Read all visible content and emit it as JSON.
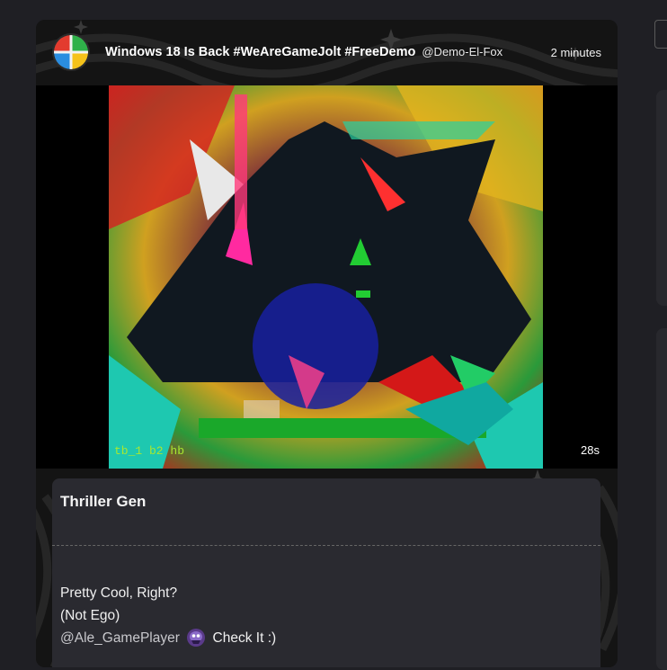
{
  "post": {
    "title": "Windows 18 Is Back #WeAreGameJolt #FreeDemo",
    "username": "@Demo-El-Fox",
    "time": "2 minutes",
    "video": {
      "duration": "28s",
      "overlay_text": "tb_1 b2 hb"
    },
    "card": {
      "title": "Thriller Gen",
      "lines": [
        "Pretty Cool, Right?",
        "(Not Ego)"
      ],
      "mention": "@Ale_GamePlayer",
      "mention_suffix": "Check It :)"
    }
  },
  "icons": {
    "avatar": "windows-logo-icon",
    "emoji": "purple-ghost-emoji-icon"
  },
  "colors": {
    "background": "#1f1f24",
    "card": "#2a2a30",
    "accent_green": "#22cc33",
    "accent_red": "#e01818"
  }
}
